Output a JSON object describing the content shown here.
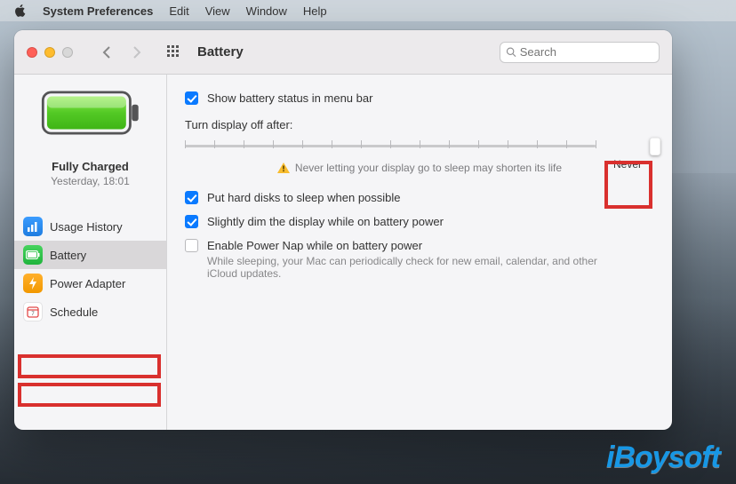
{
  "menubar": {
    "app_name": "System Preferences",
    "items": [
      "Edit",
      "View",
      "Window",
      "Help"
    ]
  },
  "window": {
    "title": "Battery",
    "search_placeholder": "Search"
  },
  "sidebar": {
    "status_title": "Fully Charged",
    "status_time": "Yesterday, 18:01",
    "items": [
      {
        "icon": "usage-history-icon",
        "label": "Usage History"
      },
      {
        "icon": "battery-icon",
        "label": "Battery"
      },
      {
        "icon": "power-adapter-icon",
        "label": "Power Adapter"
      },
      {
        "icon": "schedule-icon",
        "label": "Schedule"
      }
    ]
  },
  "settings": {
    "show_status_label": "Show battery status in menu bar",
    "show_status_checked": true,
    "slider_heading": "Turn display off after:",
    "slider_value_label": "Never",
    "warning_text": "Never letting your display go to sleep may shorten its life",
    "hard_disks_label": "Put hard disks to sleep when possible",
    "hard_disks_checked": true,
    "dim_label": "Slightly dim the display while on battery power",
    "dim_checked": true,
    "powernap_label": "Enable Power Nap while on battery power",
    "powernap_checked": false,
    "powernap_desc": "While sleeping, your Mac can periodically check for new email, calendar, and other iCloud updates."
  },
  "watermark": "iBoysoft"
}
